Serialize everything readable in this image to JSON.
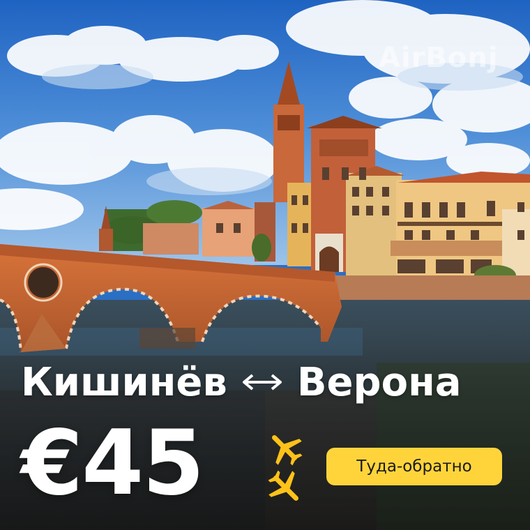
{
  "brand": {
    "watermark": "AirBonj"
  },
  "route": {
    "origin": "Кишинёв",
    "destination": "Верона",
    "arrow_icon": "double-arrow-icon"
  },
  "price": {
    "label": "€45"
  },
  "badge": {
    "label": "Туда-обратно"
  },
  "colors": {
    "badge_bg": "#ffd43b",
    "accent_yellow": "#ffc21a",
    "text": "#ffffff",
    "sky": "#2b6fc4"
  }
}
